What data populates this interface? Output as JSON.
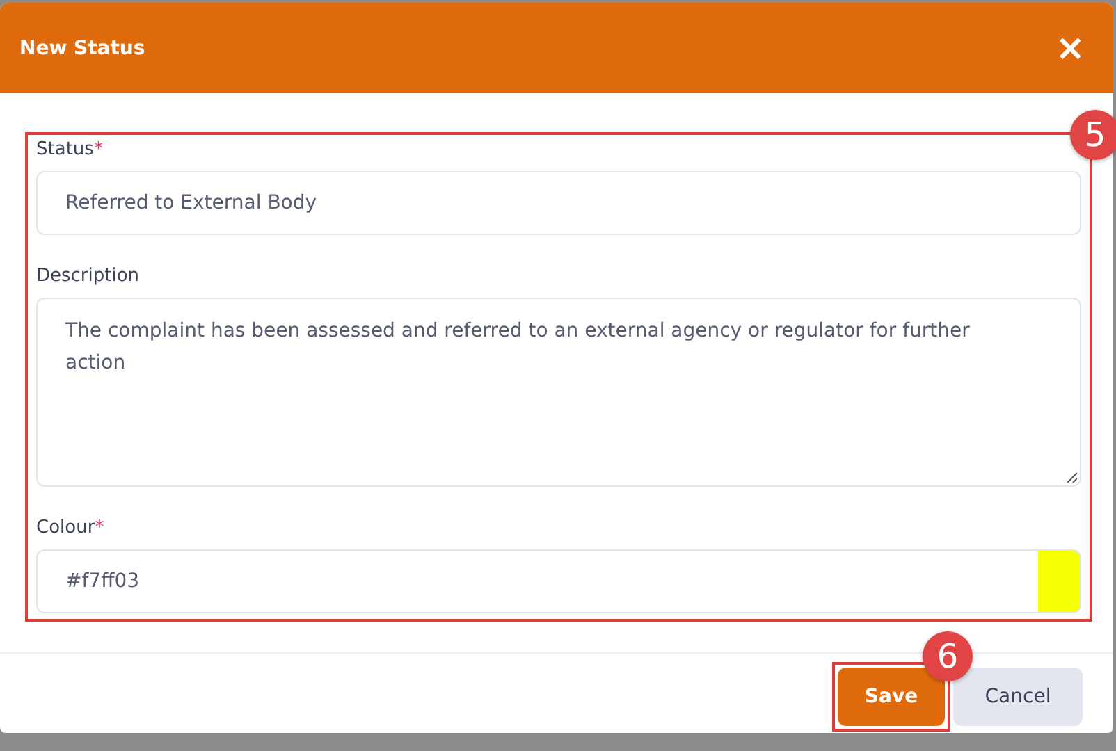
{
  "dialog": {
    "title": "New Status",
    "close": "×"
  },
  "fields": [
    {
      "kind": "input",
      "label": "Status",
      "required_mark": "*",
      "value": "Referred to External Body"
    },
    {
      "kind": "textarea",
      "label": "Description",
      "value": "The complaint has been assessed and referred to an external agency or regulator for further action"
    },
    {
      "kind": "colour",
      "label": "Colour",
      "required_mark": "*",
      "value": "#f7ff03"
    }
  ],
  "buttons": [
    {
      "label": "Save",
      "kind": "primary"
    },
    {
      "label": "Cancel",
      "kind": "secondary"
    }
  ],
  "callouts": [
    {
      "label": "5"
    },
    {
      "label": "6"
    }
  ]
}
